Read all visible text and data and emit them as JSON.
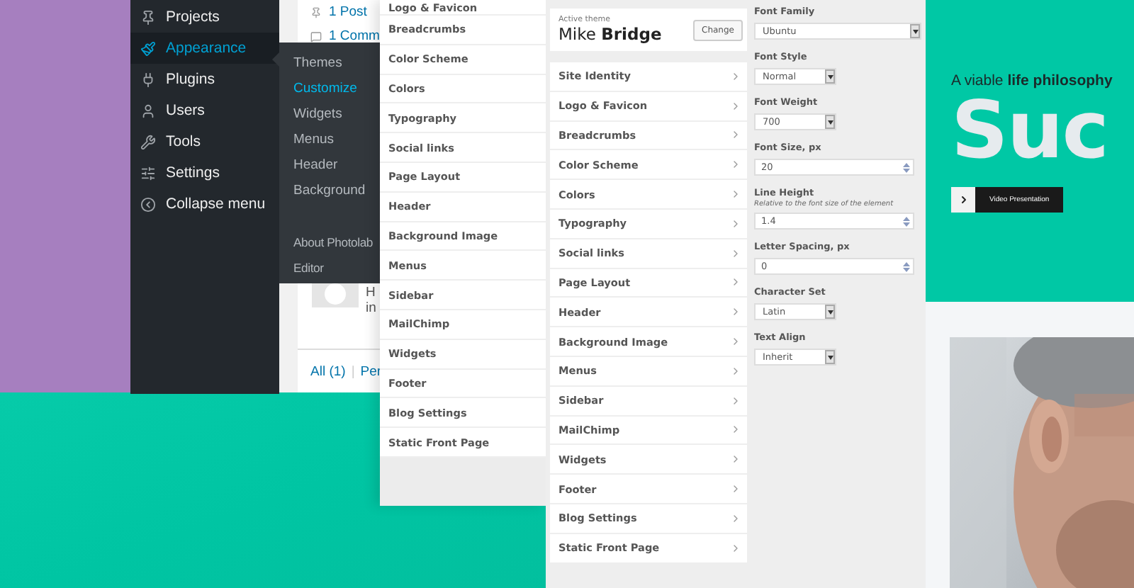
{
  "admin_menu": {
    "items": [
      {
        "label": "Projects",
        "selected": false
      },
      {
        "label": "Appearance",
        "selected": true
      },
      {
        "label": "Plugins",
        "selected": false
      },
      {
        "label": "Users",
        "selected": false
      },
      {
        "label": "Tools",
        "selected": false
      },
      {
        "label": "Settings",
        "selected": false
      },
      {
        "label": "Collapse menu",
        "selected": false
      }
    ]
  },
  "submenu": {
    "items": [
      {
        "label": "Themes",
        "selected": false
      },
      {
        "label": "Customize",
        "selected": true
      },
      {
        "label": "Widgets",
        "selected": false
      },
      {
        "label": "Menus",
        "selected": false
      },
      {
        "label": "Header",
        "selected": false
      },
      {
        "label": "Background",
        "selected": false
      }
    ],
    "extra_items": [
      {
        "label": "About Photolab",
        "selected": false
      },
      {
        "label": "Editor",
        "selected": false
      }
    ]
  },
  "activity_box": {
    "posts": "1 Post",
    "comments": "1 Comm",
    "comment_author": "H",
    "comment_text": "in",
    "filters": [
      "All (1)",
      "Per"
    ],
    "separator": "|"
  },
  "customizer_back": {
    "sections": [
      "Logo & Favicon",
      "Breadcrumbs",
      "Color Scheme",
      "Colors",
      "Typography",
      "Social links",
      "Page Layout",
      "Header",
      "Background Image",
      "Menus",
      "Sidebar",
      "MailChimp",
      "Widgets",
      "Footer",
      "Blog Settings",
      "Static Front Page"
    ]
  },
  "customizer": {
    "active_theme_label": "Active theme",
    "theme_name": "Mike **Bridge**",
    "change_button": "Change",
    "sections": [
      "Site Identity",
      "Logo & Favicon",
      "Breadcrumbs",
      "Color Scheme",
      "Colors",
      "Typography",
      "Social links",
      "Page Layout",
      "Header",
      "Background Image",
      "Menus",
      "Sidebar",
      "MailChimp",
      "Widgets",
      "Footer",
      "Blog Settings",
      "Static Front Page"
    ]
  },
  "typography": {
    "fields": [
      {
        "kind": "wide-select",
        "label": "Font Family",
        "value": "Ubuntu"
      },
      {
        "kind": "select",
        "label": "Font Style",
        "value": "Normal"
      },
      {
        "kind": "select",
        "label": "Font Weight",
        "value": "700"
      },
      {
        "kind": "number",
        "label": "Font Size, px",
        "value": "20"
      },
      {
        "kind": "number",
        "label": "Line Height",
        "description": "Relative to the font size of the element",
        "value": "1.4"
      },
      {
        "kind": "number",
        "label": "Letter Spacing, px",
        "value": "0"
      },
      {
        "kind": "select",
        "label": "Character Set",
        "value": "Latin"
      },
      {
        "kind": "select",
        "label": "Text Align",
        "value": "Inherit"
      }
    ]
  },
  "preview": {
    "tagline": "A viable **life philosophy**",
    "headline": "Suc",
    "video_button": "Video Presentation"
  }
}
